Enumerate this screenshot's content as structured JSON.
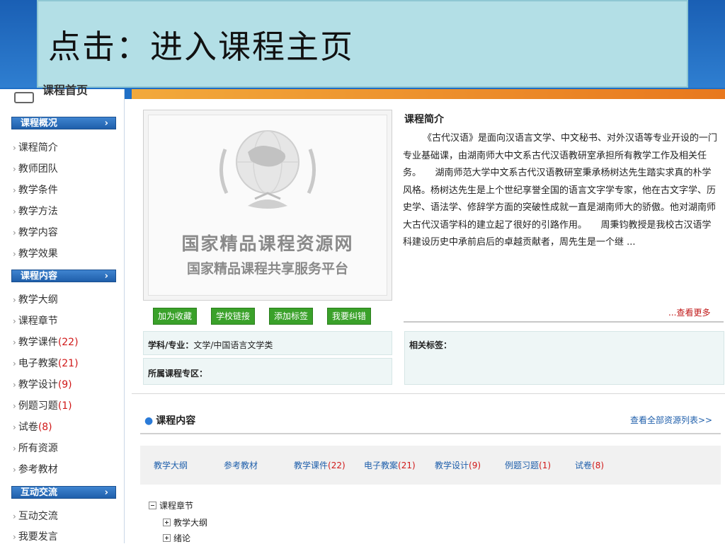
{
  "slide_title": "点击：进入课程主页",
  "sidebar": {
    "header": "课程首页",
    "sections": [
      {
        "label": "课程概况",
        "arrow": "›"
      },
      {
        "label": "课程内容",
        "arrow": "›"
      },
      {
        "label": "互动交流",
        "arrow": "›"
      }
    ],
    "chevron": "›",
    "items": [
      {
        "label": "课程简介",
        "count": ""
      },
      {
        "label": "教师团队",
        "count": ""
      },
      {
        "label": "教学条件",
        "count": ""
      },
      {
        "label": "教学方法",
        "count": ""
      },
      {
        "label": "教学内容",
        "count": ""
      },
      {
        "label": "教学效果",
        "count": ""
      },
      {
        "label": "教学大纲",
        "count": ""
      },
      {
        "label": "课程章节",
        "count": ""
      },
      {
        "label": "教学课件",
        "count": "(22)"
      },
      {
        "label": "电子教案",
        "count": "(21)"
      },
      {
        "label": "教学设计",
        "count": "(9)"
      },
      {
        "label": "例题习题",
        "count": "(1)"
      },
      {
        "label": "试卷",
        "count": "(8)"
      },
      {
        "label": "所有资源",
        "count": ""
      },
      {
        "label": "参考教材",
        "count": ""
      },
      {
        "label": "互动交流",
        "count": ""
      },
      {
        "label": "我要发言",
        "count": ""
      }
    ]
  },
  "thumbnail": {
    "line1": "国家精品课程资源网",
    "line2": "国家精品课程共享服务平台"
  },
  "buttons": {
    "favorite": "加为收藏",
    "school_link": "学校链接",
    "add_tag": "添加标签",
    "report_error": "我要纠错"
  },
  "info": {
    "subject_label": "学科/专业：",
    "subject_value": "文学/中国语言文学类",
    "zone_label": "所属课程专区：",
    "tags_label": "相关标签："
  },
  "intro": {
    "title": "课程简介",
    "text": "《古代汉语》是面向汉语言文学、中文秘书、对外汉语等专业开设的一门专业基础课，由湖南师大中文系古代汉语教研室承担所有教学工作及相关任务。　　湖南师范大学中文系古代汉语教研室秉承杨树达先生踏实求真的朴学风格。杨树达先生是上个世纪享誉全国的语言文字学专家，他在古文字学、历史学、语法学、修辞学方面的突破性成就一直是湖南师大的骄傲。他对湖南师大古代汉语学科的建立起了很好的引路作用。　　周秉钧教授是我校古汉语学科建设历史中承前启后的卓越贡献者，周先生是一个继 ...",
    "more": "...查看更多"
  },
  "content": {
    "title": "课程内容",
    "view_all": "查看全部资源列表>>",
    "tabs": [
      {
        "label": "教学大纲",
        "count": ""
      },
      {
        "label": "参考教材",
        "count": ""
      },
      {
        "label": "教学课件",
        "count": "(22)"
      },
      {
        "label": "电子教案",
        "count": "(21)"
      },
      {
        "label": "教学设计",
        "count": "(9)"
      },
      {
        "label": "例题习题",
        "count": "(1)"
      },
      {
        "label": "试卷",
        "count": "(8)"
      }
    ],
    "tree": {
      "root": "课程章节",
      "children": [
        "教学大纲",
        "绪论"
      ]
    }
  },
  "colors": {
    "brand_blue": "#1f5fab",
    "button_green": "#3aa12a",
    "count_red": "#d01818",
    "title_box": "#b3dfe6"
  }
}
